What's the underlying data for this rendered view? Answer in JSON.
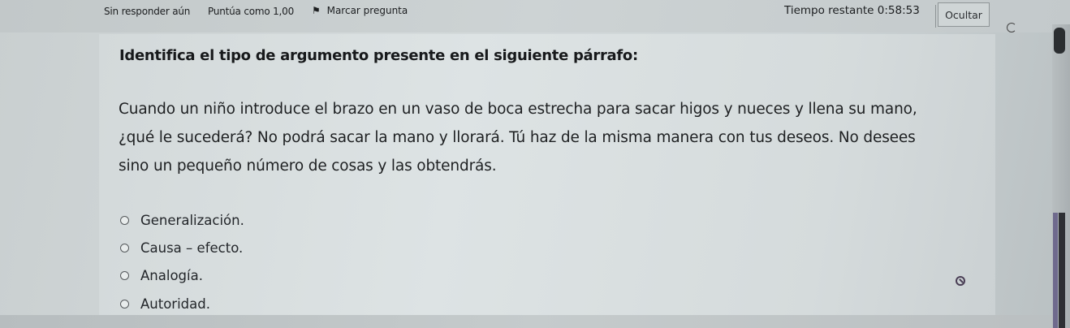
{
  "header": {
    "status": "Sin responder aún",
    "score": "Puntúa como 1,00",
    "flag_label": "Marcar pregunta",
    "timer_label": "Tiempo restante",
    "timer_value": "0:58:53",
    "hide_label": "Ocultar"
  },
  "question": {
    "title": "Identifica el tipo de argumento presente en el siguiente párrafo:",
    "lines": [
      "Cuando un niño introduce el brazo en un vaso de boca estrecha para sacar higos y nueces y llena su mano,",
      "¿qué le sucederá? No podrá sacar la mano y llorará. Tú haz de la misma manera con tus deseos. No desees",
      "sino un pequeño número de cosas y las obtendrás."
    ],
    "options": [
      "Generalización.",
      "Causa – efecto.",
      "Analogía.",
      "Autoridad."
    ]
  },
  "icons": {
    "flag": "flag-icon",
    "refresh": "refresh-icon",
    "cursor": "no-entry-cursor-icon"
  }
}
